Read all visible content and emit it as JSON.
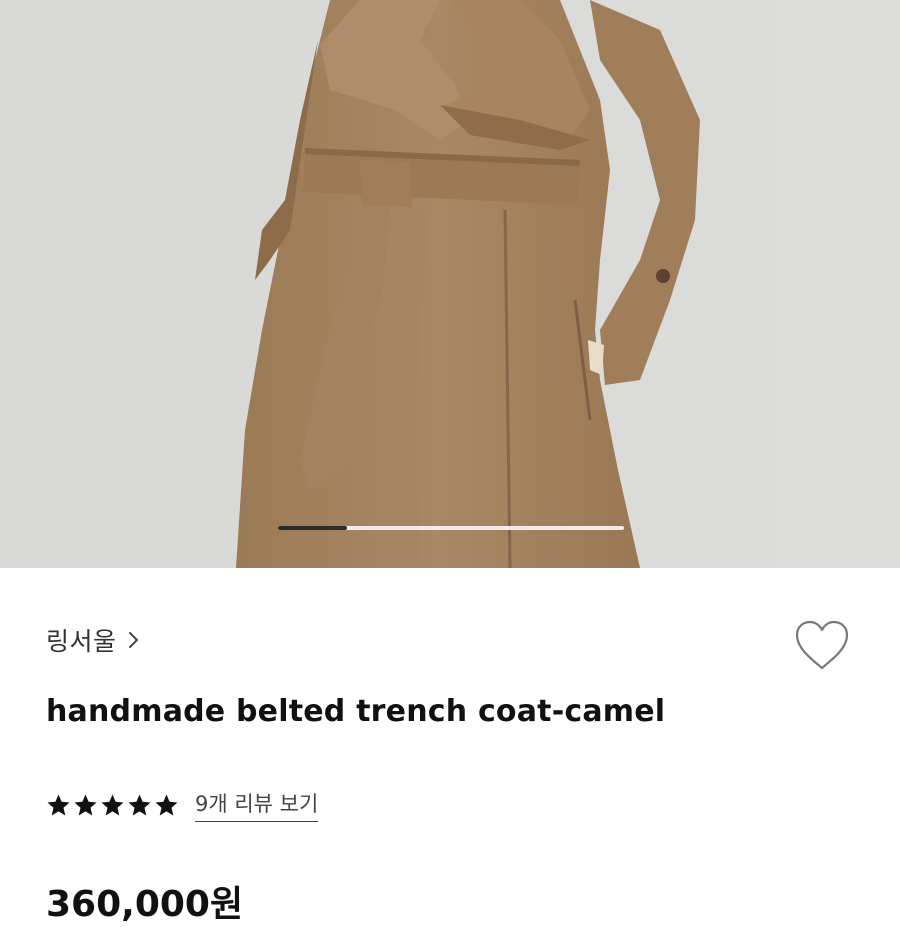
{
  "product": {
    "image_alt": "handmade belted trench coat-camel",
    "image_progress_fraction": 0.2,
    "brand": "링서울",
    "title": "handmade belted trench coat-camel",
    "rating": {
      "stars": 5,
      "max": 5,
      "reviews_link": "9개 리뷰 보기"
    },
    "price": "360,000원"
  },
  "colors": {
    "coat": "#a4835f",
    "background": "#d9d9d7",
    "text": "#111111",
    "muted": "#444444"
  },
  "icons": {
    "wishlist": "heart-outline-icon",
    "brand_chevron": "chevron-right-icon",
    "rating": "star-icon"
  }
}
